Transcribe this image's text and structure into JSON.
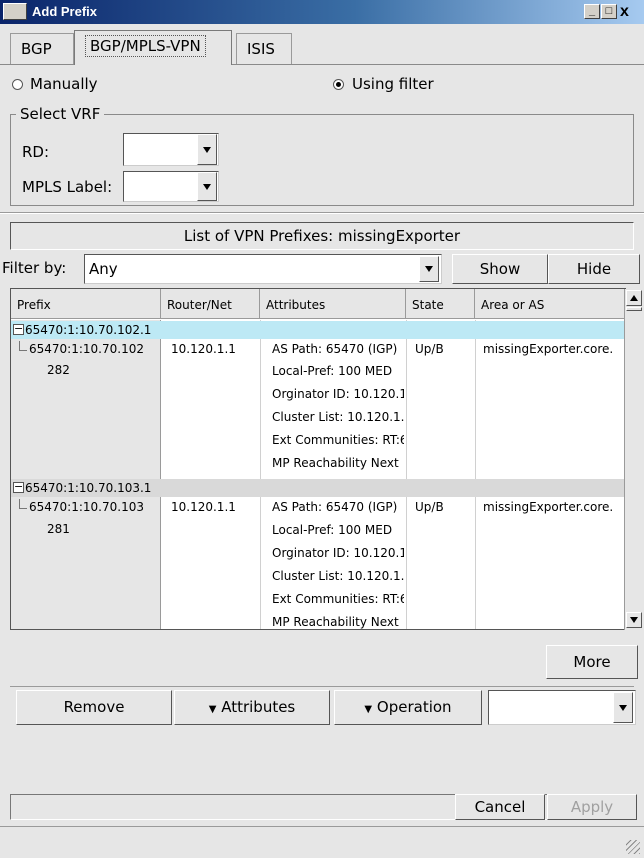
{
  "window": {
    "title": "Add Prefix",
    "controls": [
      "_",
      "□",
      "x"
    ]
  },
  "tabs": [
    {
      "label": "BGP",
      "active": false
    },
    {
      "label": "BGP/MPLS-VPN",
      "active": true
    },
    {
      "label": "ISIS",
      "active": false
    }
  ],
  "mode": {
    "manual_label": "Manually",
    "filter_label": "Using filter",
    "selected": "Using filter"
  },
  "vrf": {
    "group_label": "Select VRF",
    "rd_label": "RD:",
    "rd_value": "",
    "mpls_label": "MPLS Label:",
    "mpls_value": ""
  },
  "list": {
    "title": "List of VPN Prefixes: missingExporter",
    "filter_label": "Filter by:",
    "filter_value": "Any",
    "show_label": "Show",
    "hide_label": "Hide"
  },
  "table": {
    "columns": [
      "Prefix",
      "Router/Net",
      "Attributes",
      "State",
      "Area or AS"
    ],
    "groups": [
      {
        "prefix": "65470:1:10.70.102.1",
        "child_prefix": "65470:1:10.70.102",
        "child_number": "282",
        "router": "10.120.1.1",
        "state": "Up/B",
        "area": "missingExporter.core.",
        "attributes": [
          "AS Path: 65470 (IGP)",
          "Local-Pref: 100  MED",
          "Orginator ID: 10.120.1",
          "Cluster List: 10.120.1.",
          "Ext Communities: RT:6",
          "MP Reachability Next"
        ]
      },
      {
        "prefix": "65470:1:10.70.103.1",
        "child_prefix": "65470:1:10.70.103",
        "child_number": "281",
        "router": "10.120.1.1",
        "state": "Up/B",
        "area": "missingExporter.core.",
        "attributes": [
          "AS Path: 65470 (IGP)",
          "Local-Pref: 100  MED",
          "Orginator ID: 10.120.1",
          "Cluster List: 10.120.1.",
          "Ext Communities: RT:6",
          "MP Reachability Next"
        ]
      }
    ]
  },
  "actions": {
    "more_label": "More",
    "remove_label": "Remove",
    "attributes_label": "Attributes",
    "operation_label": "Operation",
    "operation_value": ""
  },
  "footer": {
    "cancel_label": "Cancel",
    "apply_label": "Apply"
  },
  "colors": {
    "selected_row": "#bde9f5",
    "second_row": "#d9d9d9",
    "title_bar": "#0a246a"
  }
}
